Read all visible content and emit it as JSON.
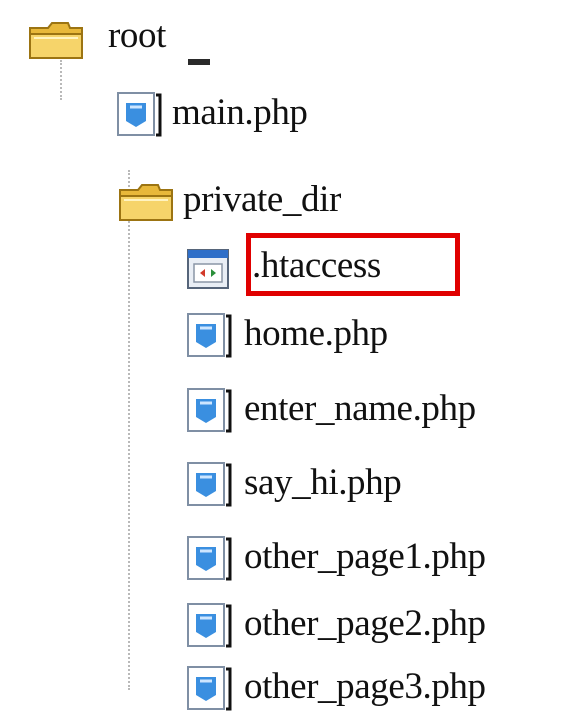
{
  "tree": {
    "root": {
      "label": "root",
      "icon": "folder-icon"
    },
    "main": {
      "label": "main.php",
      "icon": "php-file-icon"
    },
    "private_dir": {
      "label": "private_dir",
      "icon": "folder-icon"
    },
    "htaccess": {
      "label": ".htaccess",
      "icon": "config-file-icon",
      "highlighted": true
    },
    "files": [
      {
        "label": "home.php",
        "icon": "php-file-icon"
      },
      {
        "label": "enter_name.php",
        "icon": "php-file-icon"
      },
      {
        "label": "say_hi.php",
        "icon": "php-file-icon"
      },
      {
        "label": "other_page1.php",
        "icon": "php-file-icon"
      },
      {
        "label": "other_page2.php",
        "icon": "php-file-icon"
      },
      {
        "label": "other_page3.php",
        "icon": "php-file-icon"
      }
    ]
  },
  "colors": {
    "highlight": "#e00000",
    "folder": "#f2c64a",
    "file_icon_blue": "#3a8fe0"
  }
}
